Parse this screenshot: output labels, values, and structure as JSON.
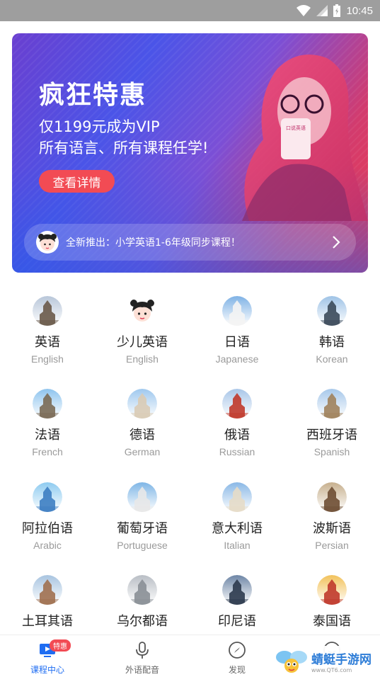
{
  "status_bar": {
    "time": "10:45"
  },
  "banner": {
    "title": "疯狂特惠",
    "subtitle_line1": "仅1199元成为VIP",
    "subtitle_line2": "所有语言、所有课程任学!",
    "button_label": "查看详情",
    "cup_text": "口说英语",
    "notice_text": "全新推出：小学英语1-6年级同步课程！"
  },
  "languages": [
    {
      "name": "英语",
      "english": "English",
      "icon": "city-skyline-icon"
    },
    {
      "name": "少儿英语",
      "english": "English",
      "icon": "kid-avatar-icon"
    },
    {
      "name": "日语",
      "english": "Japanese",
      "icon": "mount-fuji-icon"
    },
    {
      "name": "韩语",
      "english": "Korean",
      "icon": "korean-palace-icon"
    },
    {
      "name": "法语",
      "english": "French",
      "icon": "eiffel-tower-icon"
    },
    {
      "name": "德语",
      "english": "German",
      "icon": "castle-icon"
    },
    {
      "name": "俄语",
      "english": "Russian",
      "icon": "kremlin-icon"
    },
    {
      "name": "西班牙语",
      "english": "Spanish",
      "icon": "sagrada-familia-icon"
    },
    {
      "name": "阿拉伯语",
      "english": "Arabic",
      "icon": "burj-al-arab-icon"
    },
    {
      "name": "葡萄牙语",
      "english": "Portuguese",
      "icon": "tower-icon"
    },
    {
      "name": "意大利语",
      "english": "Italian",
      "icon": "leaning-tower-icon"
    },
    {
      "name": "波斯语",
      "english": "Persian",
      "icon": "persian-building-icon"
    },
    {
      "name": "土耳其语",
      "english": "",
      "icon": "mosque-icon"
    },
    {
      "name": "乌尔都语",
      "english": "",
      "icon": "dome-icon"
    },
    {
      "name": "印尼语",
      "english": "",
      "icon": "temple-icon"
    },
    {
      "name": "泰国语",
      "english": "",
      "icon": "thai-temple-icon"
    }
  ],
  "bottom_nav": [
    {
      "label": "课程中心",
      "badge": "特惠",
      "active": true,
      "icon": "course-center-icon"
    },
    {
      "label": "外语配音",
      "active": false,
      "icon": "microphone-icon"
    },
    {
      "label": "发现",
      "active": false,
      "icon": "compass-icon"
    },
    {
      "label": "",
      "active": false,
      "icon": "profile-icon"
    }
  ],
  "watermark": {
    "name": "蜻蜓手游网",
    "url": "www.QT6.com"
  },
  "colors": {
    "accent_blue": "#1f6df2",
    "accent_red": "#f24b54"
  }
}
